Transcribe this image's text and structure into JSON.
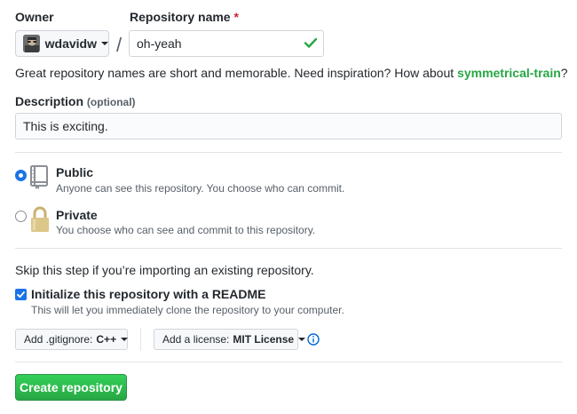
{
  "owner": {
    "label": "Owner",
    "name": "wdavidw"
  },
  "repo": {
    "label": "Repository name",
    "required_mark": "*",
    "value": "oh-yeah",
    "separator": "/"
  },
  "hint": {
    "text": "Great repository names are short and memorable. Need inspiration? How about ",
    "suggestion": "symmetrical-train",
    "end": "?"
  },
  "description": {
    "label": "Description",
    "optional": "(optional)",
    "value": "This is exciting."
  },
  "visibility": {
    "public": {
      "title": "Public",
      "subtitle": "Anyone can see this repository. You choose who can commit.",
      "selected": true
    },
    "private": {
      "title": "Private",
      "subtitle": "You choose who can see and commit to this repository.",
      "selected": false
    }
  },
  "import_note": "Skip this step if you’re importing an existing repository.",
  "readme": {
    "label": "Initialize this repository with a README",
    "subtitle": "This will let you immediately clone the repository to your computer.",
    "checked": true
  },
  "gitignore": {
    "label": "Add .gitignore:",
    "value": "C++"
  },
  "license": {
    "label": "Add a license:",
    "value": "MIT License"
  },
  "create_button": "Create repository",
  "colors": {
    "accent": "#28a745",
    "link_blue": "#0366d6",
    "radio_blue": "#1a73e8"
  }
}
